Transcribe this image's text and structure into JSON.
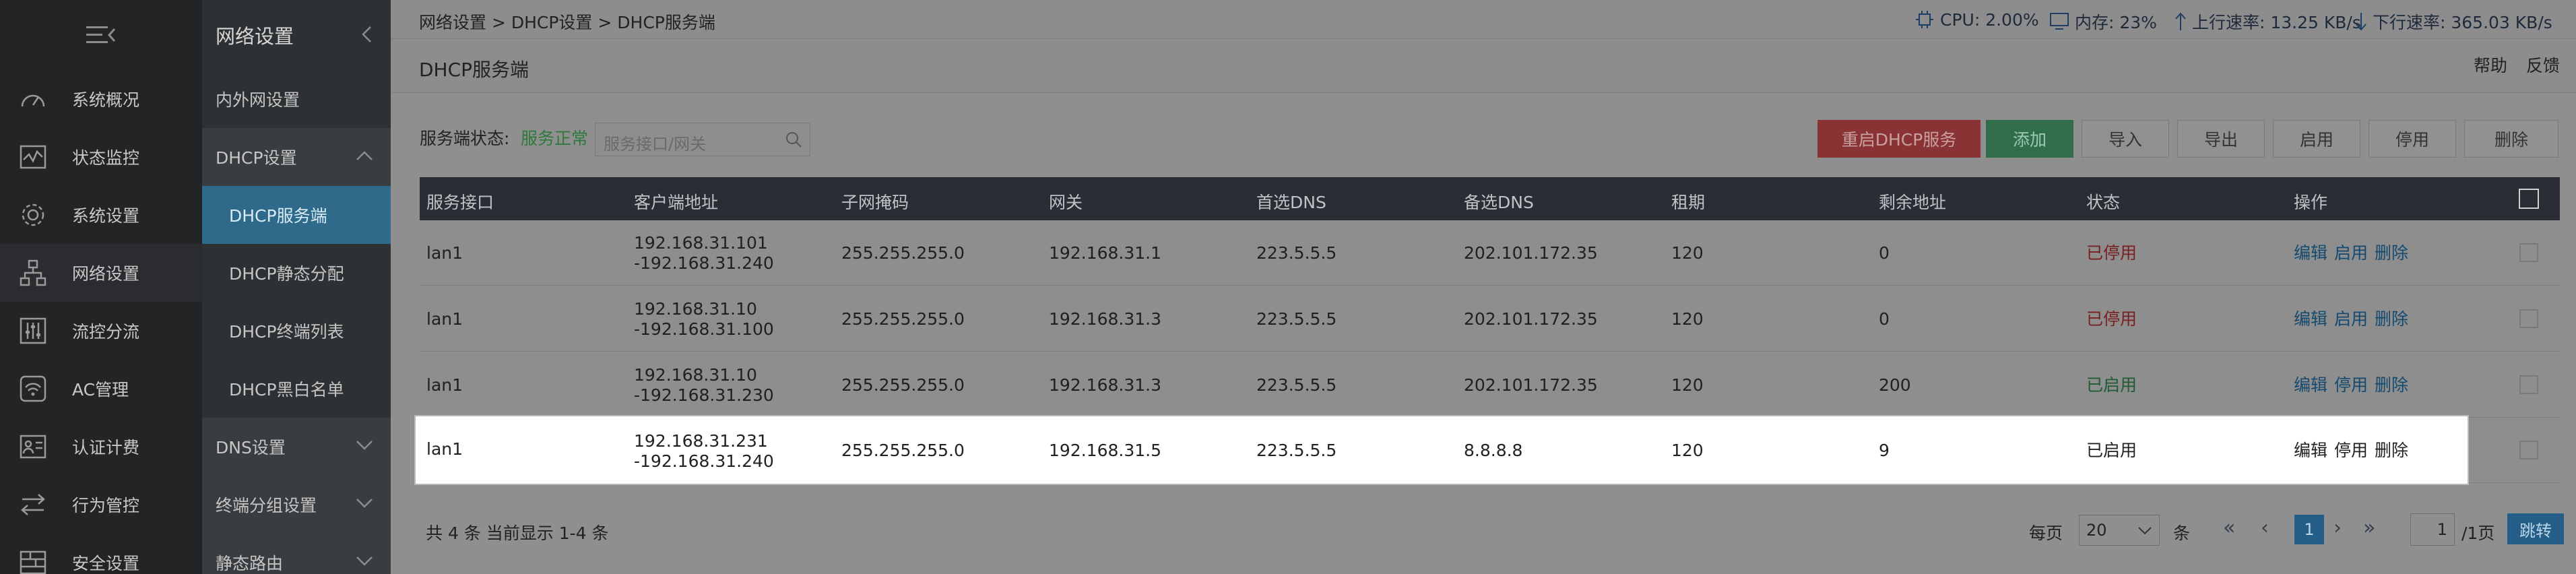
{
  "sidebar": {
    "items": [
      {
        "label": "系统概况",
        "icon": "gauge-icon"
      },
      {
        "label": "状态监控",
        "icon": "chart-monitor-icon"
      },
      {
        "label": "系统设置",
        "icon": "gear-icon"
      },
      {
        "label": "网络设置",
        "icon": "network-icon"
      },
      {
        "label": "流控分流",
        "icon": "sliders-icon"
      },
      {
        "label": "AC管理",
        "icon": "wifi-icon"
      },
      {
        "label": "认证计费",
        "icon": "id-card-icon"
      },
      {
        "label": "行为管控",
        "icon": "arrows-exchange-icon"
      },
      {
        "label": "安全设置",
        "icon": "firewall-icon"
      }
    ]
  },
  "subnav": {
    "title": "网络设置",
    "items": [
      {
        "label": "内外网设置"
      },
      {
        "label": "DHCP设置"
      },
      {
        "label": "DHCP服务端"
      },
      {
        "label": "DHCP静态分配"
      },
      {
        "label": "DHCP终端列表"
      },
      {
        "label": "DHCP黑白名单"
      },
      {
        "label": "DNS设置"
      },
      {
        "label": "终端分组设置"
      },
      {
        "label": "静态路由"
      }
    ]
  },
  "topbar": {
    "breadcrumb": "网络设置 > DHCP设置 > DHCP服务端",
    "cpu": "CPU: 2.00%",
    "mem": "内存: 23%",
    "up": "上行速率: 13.25 KB/s",
    "down": "下行速率: 365.03 KB/s"
  },
  "page": {
    "title": "DHCP服务端",
    "help": "帮助",
    "feedback": "反馈",
    "service_label": "服务端状态:",
    "service_status": "服务正常",
    "search_placeholder": "服务接口/网关"
  },
  "toolbar": {
    "restart": "重启DHCP服务",
    "add": "添加",
    "import": "导入",
    "export": "导出",
    "enable": "启用",
    "disable": "停用",
    "delete": "删除"
  },
  "table": {
    "headers": [
      "服务接口",
      "客户端地址",
      "子网掩码",
      "网关",
      "首选DNS",
      "备选DNS",
      "租期",
      "剩余地址",
      "状态",
      "操作"
    ],
    "rows": [
      {
        "iface": "lan1",
        "addr1": "192.168.31.101",
        "addr2": "-192.168.31.240",
        "mask": "255.255.255.0",
        "gw": "192.168.31.1",
        "dns1": "223.5.5.5",
        "dns2": "202.101.172.35",
        "lease": "120",
        "remain": "0",
        "status": "已停用",
        "a1": "编辑",
        "a2": "启用",
        "a3": "删除"
      },
      {
        "iface": "lan1",
        "addr1": "192.168.31.10",
        "addr2": "-192.168.31.100",
        "mask": "255.255.255.0",
        "gw": "192.168.31.3",
        "dns1": "223.5.5.5",
        "dns2": "202.101.172.35",
        "lease": "120",
        "remain": "0",
        "status": "已停用",
        "a1": "编辑",
        "a2": "启用",
        "a3": "删除"
      },
      {
        "iface": "lan1",
        "addr1": "192.168.31.10",
        "addr2": "-192.168.31.230",
        "mask": "255.255.255.0",
        "gw": "192.168.31.3",
        "dns1": "223.5.5.5",
        "dns2": "202.101.172.35",
        "lease": "120",
        "remain": "200",
        "status": "已启用",
        "a1": "编辑",
        "a2": "停用",
        "a3": "删除"
      },
      {
        "iface": "lan1",
        "addr1": "192.168.31.231",
        "addr2": "-192.168.31.240",
        "mask": "255.255.255.0",
        "gw": "192.168.31.5",
        "dns1": "223.5.5.5",
        "dns2": "8.8.8.8",
        "lease": "120",
        "remain": "9",
        "status": "已启用",
        "a1": "编辑",
        "a2": "停用",
        "a3": "删除"
      }
    ]
  },
  "footer": {
    "summary": "共 4 条 当前显示 1-4 条",
    "per_page_label": "每页",
    "per_page_value": "20",
    "unit": "条",
    "current_page": "1",
    "jump_value": "1",
    "total_pages": "/1页",
    "go": "跳转"
  },
  "colors": {
    "restart_btn": "#8a3335",
    "add_btn": "#2f6d4b",
    "enabled_status": "#23b07a",
    "disabled_status": "#c23a3a",
    "action_link": "#2a8ccc",
    "selected_nav": "#2f6a8a"
  }
}
